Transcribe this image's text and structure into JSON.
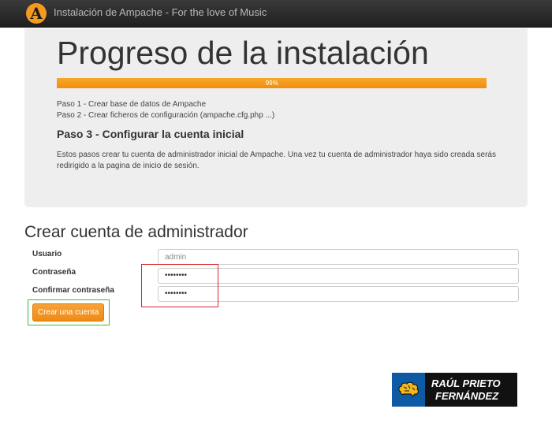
{
  "header": {
    "logo_letter": "A",
    "title": "Instalación de Ampache - For the love of Music"
  },
  "hero": {
    "title": "Progreso de la instalación",
    "progress": {
      "value_percent": 99,
      "label": "99%"
    },
    "steps": [
      "Paso 1 - Crear base de datos de Ampache",
      "Paso 2 - Crear ficheros de configuración (ampache.cfg.php ...)"
    ],
    "current_step": "Paso 3 - Configurar la cuenta inicial",
    "description": "Estos pasos crear tu cuenta de administrador inicial de Ampache. Una vez tu cuenta de administrador haya sido creada serás redirigido a la pagina de inicio de sesión."
  },
  "form": {
    "title": "Crear cuenta de administrador",
    "fields": [
      {
        "label": "Usuario",
        "value": "admin"
      },
      {
        "label": "Contraseña",
        "value": "••••••••"
      },
      {
        "label": "Confirmar contraseña",
        "value": "••••••••"
      }
    ],
    "submit_label": "Crear una cuenta"
  },
  "watermark": {
    "line1": "RAÚL PRIETO",
    "line2": "FERNÁNDEZ"
  },
  "colors": {
    "accent": "#f39a1f",
    "highlight_red": "#d9262c",
    "highlight_green": "#36c236"
  }
}
